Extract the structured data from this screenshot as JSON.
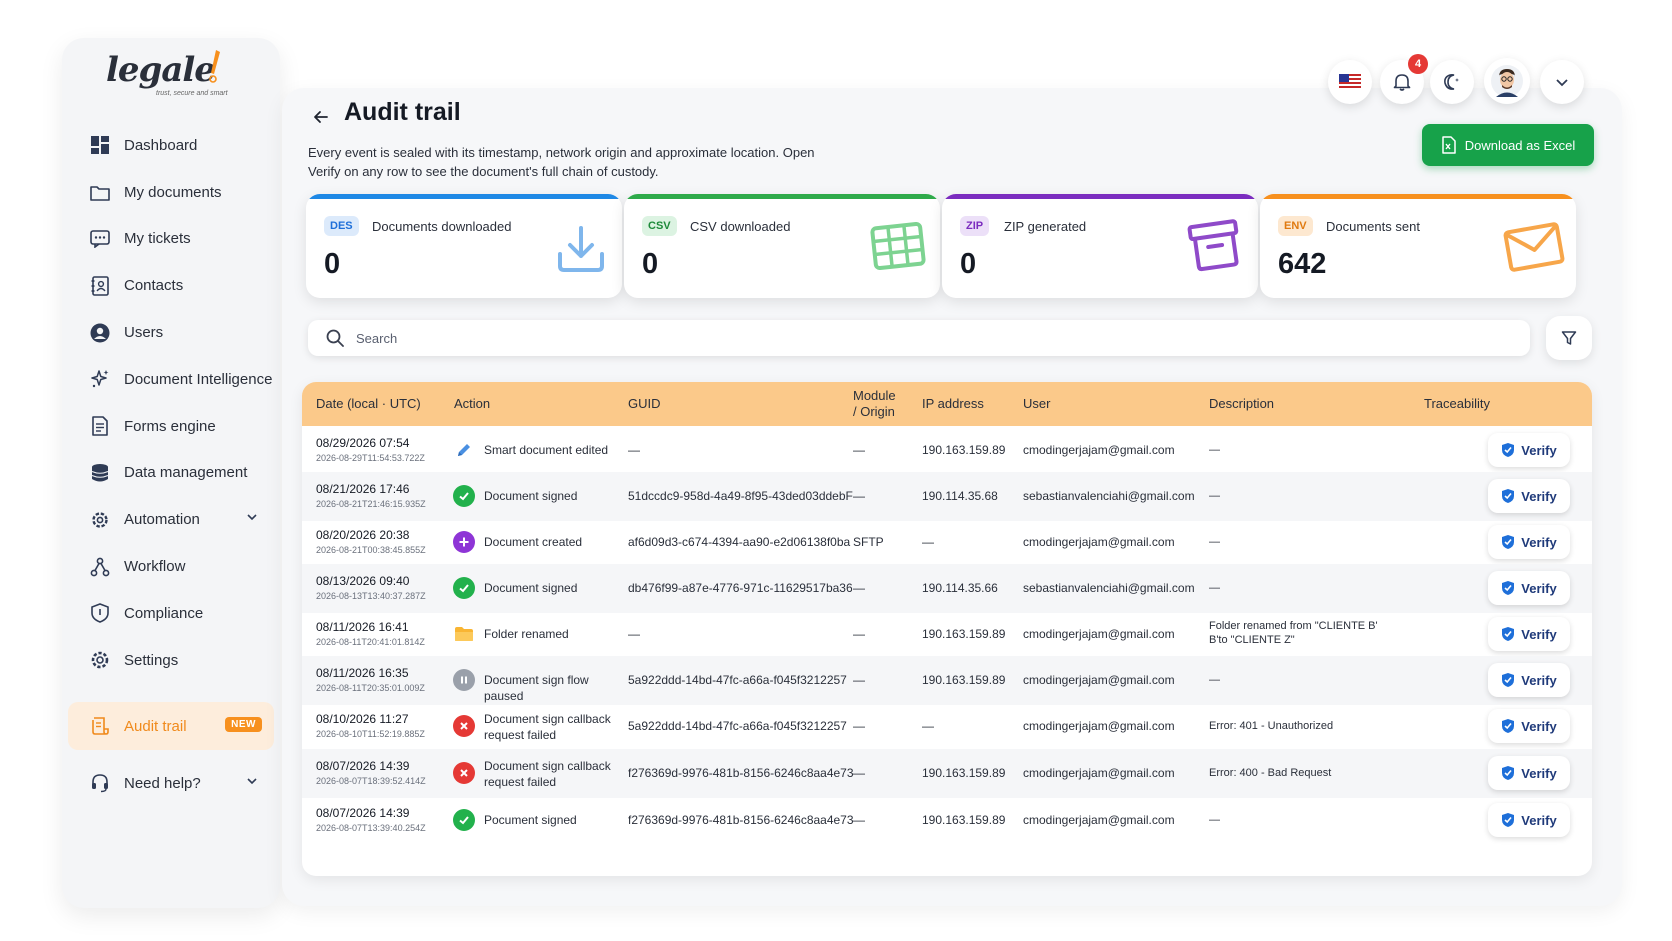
{
  "brand": {
    "name": "legale",
    "tagline": "trust, secure and smart"
  },
  "sidebar": {
    "items": [
      {
        "label": "Dashboard",
        "icon": "dashboard-icon"
      },
      {
        "label": "My documents",
        "icon": "folder-icon"
      },
      {
        "label": "My tickets",
        "icon": "ticket-icon"
      },
      {
        "label": "Contacts",
        "icon": "contacts-icon"
      },
      {
        "label": "Users",
        "icon": "user-icon"
      },
      {
        "label": "Document Intelligence",
        "icon": "sparkle-icon"
      },
      {
        "label": "Forms engine",
        "icon": "form-icon"
      },
      {
        "label": "Data management",
        "icon": "database-icon"
      },
      {
        "label": "Automation",
        "icon": "automation-icon"
      },
      {
        "label": "Workflow",
        "icon": "workflow-icon"
      },
      {
        "label": "Compliance",
        "icon": "shield-icon"
      },
      {
        "label": "Settings",
        "icon": "gear-icon"
      }
    ],
    "active": {
      "label": "Audit trail",
      "badge": "NEW"
    },
    "help": {
      "label": "Need help?"
    }
  },
  "topbar": {
    "notifications_count": "4"
  },
  "page": {
    "title": "Audit trail",
    "description": "Every event is sealed with its timestamp, network origin and approximate location. Open Verify on any row to see the document's full chain of custody.",
    "download_button": "Download as Excel"
  },
  "cards": [
    {
      "code": "DES",
      "label": "Documents downloaded",
      "value": "0",
      "color": "#1e88e5"
    },
    {
      "code": "CSV",
      "label": "CSV downloaded",
      "value": "0",
      "color": "#2eaa4a"
    },
    {
      "code": "ZIP",
      "label": "ZIP generated",
      "value": "0",
      "color": "#7b2cbf"
    },
    {
      "code": "ENV",
      "label": "Documents sent",
      "value": "642",
      "color": "#f7901e"
    }
  ],
  "search": {
    "placeholder": "Search"
  },
  "table": {
    "headers": {
      "date": "Date (local · UTC)",
      "action": "Action",
      "guid": "GUID",
      "module_line1": "Module",
      "module_line2": "/ Origin",
      "ip": "IP address",
      "user": "User",
      "description": "Description",
      "traceability": "Traceability"
    },
    "verify_label": "Verify",
    "rows": [
      {
        "date": "08/29/2026 07:54",
        "utc": "2026-08-29T11:54:53.722Z",
        "action_icon": "pencil-icon",
        "action": "Smart document edited",
        "guid": "—",
        "module": "—",
        "ip": "190.163.159.89",
        "user": "cmodingerjajam@gmail.com",
        "description": "—"
      },
      {
        "date": "08/21/2026 17:46",
        "utc": "2026-08-21T21:46:15.935Z",
        "action_icon": "check-icon",
        "action": "Document signed",
        "guid": "51dccdc9-958d-4a49-8f95-43ded03ddebF",
        "module": "—",
        "ip": "190.114.35.68",
        "user": "sebastianvalenciahi@gmail.com",
        "description": "—"
      },
      {
        "date": "08/20/2026 20:38",
        "utc": "2026-08-21T00:38:45.855Z",
        "action_icon": "plus-icon",
        "action": "Document created",
        "guid": "af6d09d3-c674-4394-aa90-e2d06138f0ba",
        "module": "SFTP",
        "ip": "—",
        "user": "cmodingerjajam@gmail.com",
        "description": "—"
      },
      {
        "date": "08/13/2026 09:40",
        "utc": "2026-08-13T13:40:37.287Z",
        "action_icon": "check-icon",
        "action": "Document signed",
        "guid": "db476f99-a87e-4776-971c-11629517ba36",
        "module": "—",
        "ip": "190.114.35.66",
        "user": "sebastianvalenciahi@gmail.com",
        "description": "—"
      },
      {
        "date": "08/11/2026 16:41",
        "utc": "2026-08-11T20:41:01.814Z",
        "action_icon": "folder-icon",
        "action": "Folder renamed",
        "guid": "—",
        "module": "—",
        "ip": "190.163.159.89",
        "user": "cmodingerjajam@gmail.com",
        "description": "Folder renamed from \"CLIENTE B' B'to \"CLIENTE Z\""
      },
      {
        "date": "08/11/2026 16:35",
        "utc": "2026-08-11T20:35:01.009Z",
        "action_icon": "pause-icon",
        "action": "Document sign flow paused",
        "guid": "5a922ddd-14bd-47fc-a66a-f045f3212257",
        "module": "—",
        "ip": "190.163.159.89",
        "user": "cmodingerjajam@gmail.com",
        "description": "—"
      },
      {
        "date": "08/10/2026 11:27",
        "utc": "2026-08-10T11:52:19.885Z",
        "action_icon": "error-icon",
        "action": "Document sign callback request failed",
        "guid": "5a922ddd-14bd-47fc-a66a-f045f3212257",
        "module": "—",
        "ip": "—",
        "user": "cmodingerjajam@gmail.com",
        "description": "Error: 401 - Unauthorized"
      },
      {
        "date": "08/07/2026 14:39",
        "utc": "2026-08-07T18:39:52.414Z",
        "action_icon": "error-icon",
        "action": "Document sign callback request failed",
        "guid": "f276369d-9976-481b-8156-6246c8aa4e73",
        "module": "—",
        "ip": "190.163.159.89",
        "user": "cmodingerjajam@gmail.com",
        "description": "Error: 400 - Bad Request"
      },
      {
        "date": "08/07/2026 14:39",
        "utc": "2026-08-07T13:39:40.254Z",
        "action_icon": "check-icon",
        "action": "Pocument signed",
        "guid": "f276369d-9976-481b-8156-6246c8aa4e73",
        "module": "—",
        "ip": "190.163.159.89",
        "user": "cmodingerjajam@gmail.com",
        "description": "—"
      }
    ]
  },
  "colors": {
    "accent": "#f7901e",
    "header_bg": "#fbc98a",
    "excel_green": "#17a24a",
    "verify_blue": "#1e6fd9"
  }
}
